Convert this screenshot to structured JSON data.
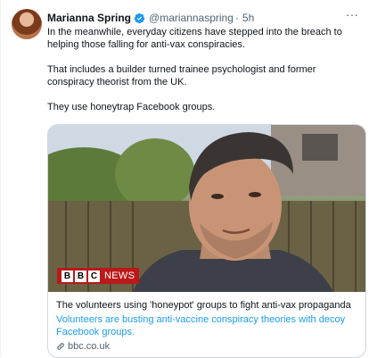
{
  "tweet": {
    "author": {
      "name": "Marianna Spring",
      "handle": "@mariannaspring",
      "separator": "·",
      "time": "5h"
    },
    "more_glyph": "···",
    "paragraphs": [
      "In the meanwhile, everyday citizens have stepped into the breach to helping those falling for anti-vax conspiracies.",
      "That includes a builder turned trainee psychologist and former conspiracy theorist from the UK.",
      "They use honeytrap Facebook groups."
    ],
    "card": {
      "badge_letters": [
        "B",
        "B",
        "C"
      ],
      "badge_word": "NEWS",
      "title": "The volunteers using 'honeypot' groups to fight anti-vax propaganda",
      "description": "Volunteers are busting anti-vaccine conspiracy theories with decoy Facebook groups.",
      "domain": "bbc.co.uk"
    }
  },
  "colors": {
    "accent_blue": "#1d9bf0",
    "secondary_text": "#536471",
    "bbc_red": "#bb1919",
    "border": "#cfd9de"
  },
  "icons": {
    "verified": "verified-badge-icon",
    "more": "more-icon",
    "link": "link-icon"
  }
}
